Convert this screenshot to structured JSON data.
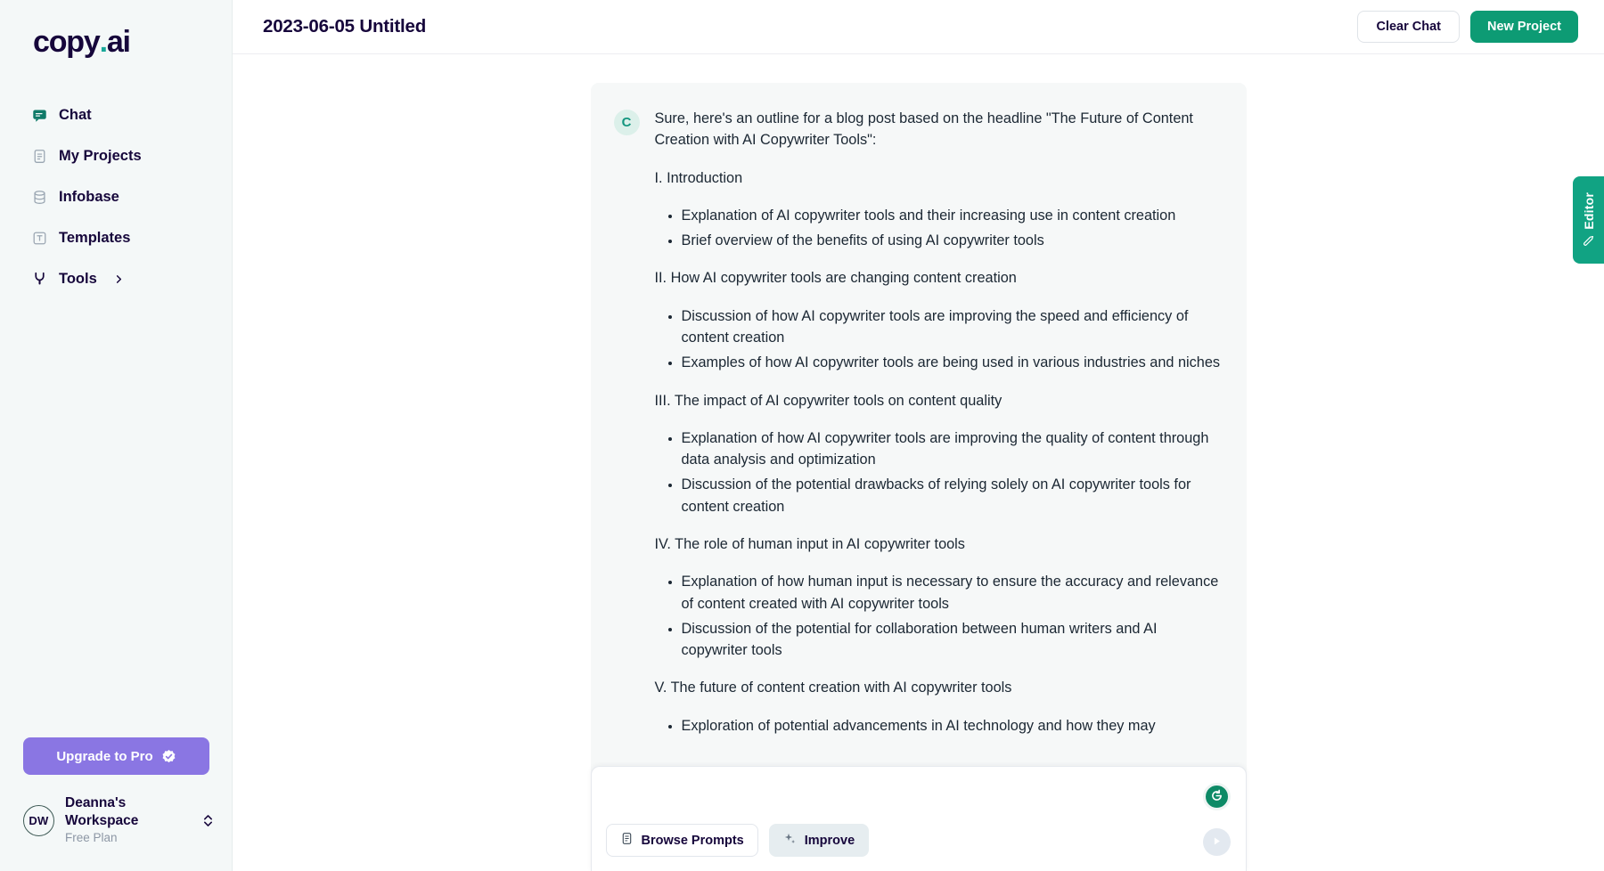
{
  "brand": {
    "logo_main": "copy",
    "logo_dot": ".",
    "logo_suffix": "ai",
    "accent_teal": "#1aa99a",
    "accent_green": "#0d9b74",
    "accent_purple": "#8a76e3",
    "sidebar_bg": "#f4f8f8",
    "card_bg": "#f6f8f8"
  },
  "sidebar": {
    "items": [
      {
        "label": "Chat",
        "icon": "chat-bubble-icon",
        "active": true
      },
      {
        "label": "My Projects",
        "icon": "document-icon",
        "active": false
      },
      {
        "label": "Infobase",
        "icon": "database-icon",
        "active": false
      },
      {
        "label": "Templates",
        "icon": "template-icon",
        "active": false
      },
      {
        "label": "Tools",
        "icon": "wrench-icon",
        "active": false,
        "chevron": "chevron-right-icon"
      }
    ],
    "upgrade": {
      "label": "Upgrade to Pro",
      "icon": "verified-badge-icon"
    },
    "workspace": {
      "initials": "DW",
      "name": "Deanna's Workspace",
      "plan": "Free Plan",
      "switch_icon": "chevron-up-down-icon"
    }
  },
  "topbar": {
    "title": "2023-06-05 Untitled",
    "clear_chat_label": "Clear Chat",
    "new_project_label": "New Project"
  },
  "editor_tab": {
    "label": "Editor",
    "icon": "pen-icon"
  },
  "conversation": {
    "avatar_initial": "C",
    "intro": "Sure, here's an outline for a blog post based on the headline \"The Future of Content Creation with AI Copywriter Tools\":",
    "sections": [
      {
        "heading": "I. Introduction",
        "bullets": [
          "Explanation of AI copywriter tools and their increasing use in content creation",
          "Brief overview of the benefits of using AI copywriter tools"
        ]
      },
      {
        "heading": "II. How AI copywriter tools are changing content creation",
        "bullets": [
          "Discussion of how AI copywriter tools are improving the speed and efficiency of content creation",
          "Examples of how AI copywriter tools are being used in various industries and niches"
        ]
      },
      {
        "heading": "III. The impact of AI copywriter tools on content quality",
        "bullets": [
          "Explanation of how AI copywriter tools are improving the quality of content through data analysis and optimization",
          "Discussion of the potential drawbacks of relying solely on AI copywriter tools for content creation"
        ]
      },
      {
        "heading": "IV. The role of human input in AI copywriter tools",
        "bullets": [
          "Explanation of how human input is necessary to ensure the accuracy and relevance of content created with AI copywriter tools",
          "Discussion of the potential for collaboration between human writers and AI copywriter tools"
        ]
      },
      {
        "heading": "V. The future of content creation with AI copywriter tools",
        "bullets": [
          "Exploration of potential advancements in AI technology and how they may"
        ]
      }
    ]
  },
  "composer": {
    "placeholder": "",
    "value": "",
    "browse_prompts_label": "Browse Prompts",
    "improve_label": "Improve",
    "regenerate_icon": "refresh-icon",
    "send_icon": "send-arrow-icon",
    "browse_icon": "list-document-icon",
    "improve_icon": "sparkle-icon"
  }
}
